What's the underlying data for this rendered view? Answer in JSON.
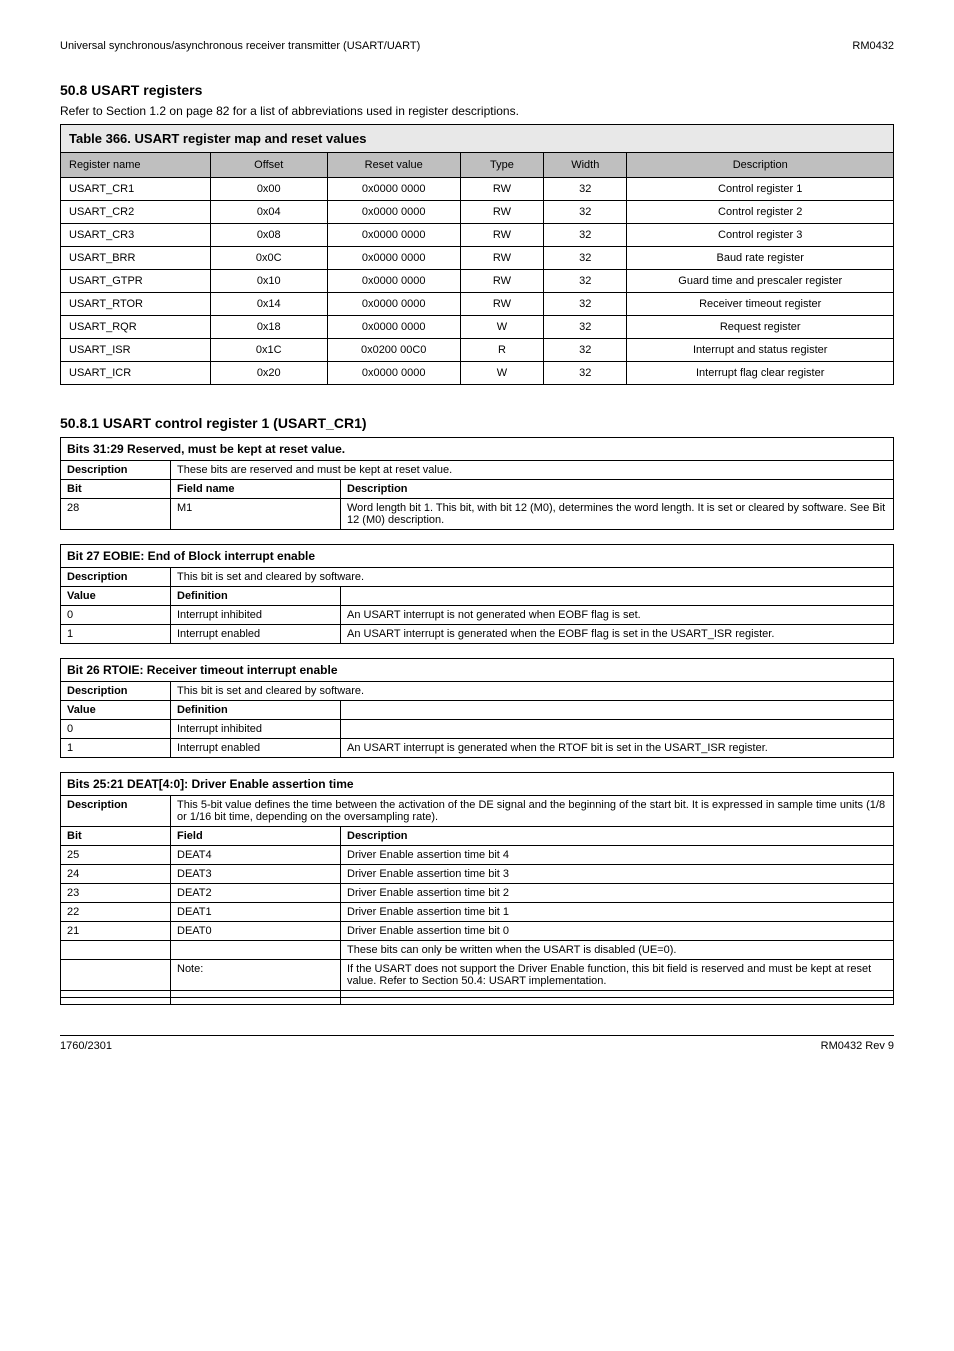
{
  "header": {
    "left": "Universal synchronous/asynchronous receiver transmitter (USART/UART)",
    "right": "RM0432"
  },
  "page_title": "50.8 USART registers",
  "intro": "Refer to Section 1.2 on page 82 for a list of abbreviations used in register descriptions.",
  "bitmap": {
    "table_no": "Table 366.",
    "title": "USART register map and reset values",
    "columns": [
      "Register name",
      "Offset",
      "Reset value",
      "Type",
      "Width",
      "Description"
    ],
    "rows": [
      [
        "USART_CR1",
        "0x00",
        "0x0000 0000",
        "RW",
        "32",
        "Control register 1"
      ],
      [
        "USART_CR2",
        "0x04",
        "0x0000 0000",
        "RW",
        "32",
        "Control register 2"
      ],
      [
        "USART_CR3",
        "0x08",
        "0x0000 0000",
        "RW",
        "32",
        "Control register 3"
      ],
      [
        "USART_BRR",
        "0x0C",
        "0x0000 0000",
        "RW",
        "32",
        "Baud rate register"
      ],
      [
        "USART_GTPR",
        "0x10",
        "0x0000 0000",
        "RW",
        "32",
        "Guard time and prescaler register"
      ],
      [
        "USART_RTOR",
        "0x14",
        "0x0000 0000",
        "RW",
        "32",
        "Receiver timeout register"
      ],
      [
        "USART_RQR",
        "0x18",
        "0x0000 0000",
        "W",
        "32",
        "Request register"
      ],
      [
        "USART_ISR",
        "0x1C",
        "0x0200 00C0",
        "R",
        "32",
        "Interrupt and status register"
      ],
      [
        "USART_ICR",
        "0x20",
        "0x0000 0000",
        "W",
        "32",
        "Interrupt flag clear register"
      ]
    ]
  },
  "section_title": "50.8.1  USART control register 1 (USART_CR1)",
  "regs": [
    {
      "title_left": "Bits 31:29",
      "title_right": "Reserved, must be kept at reset value.",
      "desc_label": "Description",
      "desc_text": "These bits are reserved and must be kept at reset value.",
      "bits_header": [
        "Bit",
        "Field name",
        "Description"
      ],
      "bits": [
        [
          "28",
          "M1",
          "Word length bit 1. This bit, with bit 12 (M0), determines the word length. It is set or cleared by software. See Bit 12 (M0) description."
        ]
      ]
    },
    {
      "title_left": "Bit 27",
      "title_right": "EOBIE: End of Block interrupt enable",
      "desc_label": "Description",
      "desc_text": "This bit is set and cleared by software.",
      "bits_header": [
        "Value",
        "Definition",
        ""
      ],
      "bits": [
        [
          "0",
          "Interrupt inhibited",
          "An USART interrupt is not generated when EOBF flag is set."
        ],
        [
          "1",
          "Interrupt enabled",
          "An USART interrupt is generated when the EOBF flag is set in the USART_ISR register."
        ]
      ]
    },
    {
      "title_left": "Bit 26",
      "title_right": "RTOIE: Receiver timeout interrupt enable",
      "desc_label": "Description",
      "desc_text": "This bit is set and cleared by software.",
      "bits_header": [
        "Value",
        "Definition",
        ""
      ],
      "bits": [
        [
          "0",
          "Interrupt inhibited",
          ""
        ],
        [
          "1",
          "Interrupt enabled",
          "An USART interrupt is generated when the RTOF bit is set in the USART_ISR register."
        ]
      ]
    },
    {
      "title_left": "Bits 25:21",
      "title_right": "DEAT[4:0]: Driver Enable assertion time",
      "desc_label": "Description",
      "desc_text": "This 5-bit value defines the time between the activation of the DE signal and the beginning of the start bit. It is expressed in sample time units (1/8 or 1/16 bit time, depending on the oversampling rate).",
      "bits_header": [
        "Bit",
        "Field",
        "Description"
      ],
      "bits": [
        [
          "25",
          "DEAT4",
          "Driver Enable assertion time bit 4"
        ],
        [
          "24",
          "DEAT3",
          "Driver Enable assertion time bit 3"
        ],
        [
          "23",
          "DEAT2",
          "Driver Enable assertion time bit 2"
        ],
        [
          "22",
          "DEAT1",
          "Driver Enable assertion time bit 1"
        ],
        [
          "21",
          "DEAT0",
          "Driver Enable assertion time bit 0"
        ],
        [
          "",
          "",
          "These bits can only be written when the USART is disabled (UE=0)."
        ],
        [
          "",
          "Note:",
          "If the USART does not support the Driver Enable function, this bit field is reserved and must be kept at reset value. Refer to Section 50.4: USART implementation."
        ],
        [
          "",
          "",
          ""
        ],
        [
          "",
          "",
          ""
        ]
      ]
    }
  ],
  "footer": {
    "left": "1760/2301",
    "right": "RM0432 Rev 9"
  },
  "footer_sub": {
    "left": "",
    "right": ""
  }
}
